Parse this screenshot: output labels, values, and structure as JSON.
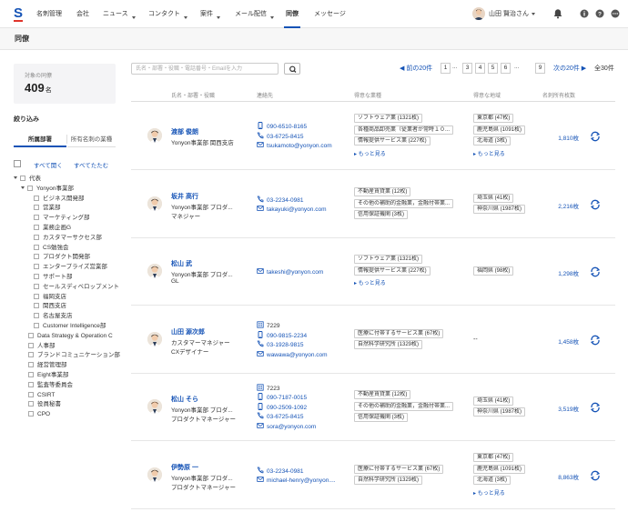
{
  "nav": {
    "logo": "S",
    "items": [
      {
        "label": "名刺管理",
        "caret": false
      },
      {
        "label": "会社",
        "caret": false
      },
      {
        "label": "ニュース",
        "caret": true
      },
      {
        "label": "コンタクト",
        "caret": true
      },
      {
        "label": "案件",
        "caret": true
      },
      {
        "label": "メール配信",
        "caret": true
      },
      {
        "label": "同僚",
        "caret": false
      },
      {
        "label": "メッセージ",
        "caret": false
      }
    ],
    "user_name": "山田 賢治さん",
    "icons": [
      "bell-icon",
      "info-icon",
      "help-icon",
      "more-icon"
    ]
  },
  "page": {
    "title": "同僚"
  },
  "summary": {
    "label": "対象の同僚",
    "value": "409",
    "unit": "名"
  },
  "filter": {
    "title": "絞り込み",
    "tab_own": "所属部署",
    "tab_all": "所有名刺の業種",
    "expand_all": "すべて開く",
    "collapse_all": "すべてたたむ",
    "tree": [
      "代表",
      "Yonyon事業部",
      "ビジネス開発部",
      "営業部",
      "マーケティング部",
      "業務企画G",
      "カスタマーサクセス部",
      "CS勉強会",
      "プロダクト開発部",
      "エンタープライズ営業部",
      "サポート部",
      "セールスディベロップメント",
      "福岡支店",
      "関西支店",
      "名古屋支店",
      "Customer Intelligence部",
      "Data Strategy & Operation C",
      "人事部",
      "ブランドコミュニケーション部",
      "経営管理部",
      "Eight事業部",
      "監査等委員会",
      "CSIRT",
      "役員秘書",
      "CPO"
    ]
  },
  "search": {
    "placeholder": "氏名・部署・役職・電話番号・Emailを入力"
  },
  "pager": {
    "prev": "前の20件",
    "next": "次の20件",
    "pages": [
      "1",
      "3",
      "4",
      "5",
      "6",
      "9"
    ],
    "dots": "...",
    "total": "全30件"
  },
  "table": {
    "headers": [
      "氏名・部署・役職",
      "連絡先",
      "得意な業種",
      "得意な地域",
      "名刺所有枚数"
    ],
    "rows": [
      {
        "name": "渡部 俊朗",
        "org": [
          "Yonyon事業部 関西支店"
        ],
        "contacts": [
          {
            "type": "mobile",
            "text": "090-6510-8165",
            "link": true
          },
          {
            "type": "phone",
            "text": "03-6725-8415",
            "link": true
          },
          {
            "type": "mail",
            "text": "tsukamoto@yonyon.com",
            "link": true
          }
        ],
        "industries": [
          "ソフトウェア業 (1321枚)",
          "各種商品卸売業（従業者が常時１０...",
          "情報提供サービス業 (227枚)"
        ],
        "industry_more": "もっと見る",
        "regions": [
          "東京都 (47枚)",
          "鹿児島県 (1091枚)",
          "北海道 (3枚)"
        ],
        "region_more": "もっと見る",
        "cards": "1,810枚"
      },
      {
        "name": "坂井 高行",
        "org": [
          "Yonyon事業部 プロダ...",
          "マネジャー"
        ],
        "contacts": [
          {
            "type": "phone",
            "text": "03-2234-0981",
            "link": true
          },
          {
            "type": "mail",
            "text": "takayuki@yonyon.com",
            "link": true
          }
        ],
        "industries": [
          "不動産賃貸業 (12枚)",
          "その他の補助的金融業，金融付帯業...",
          "信用保証機関 (3枚)"
        ],
        "industry_more": "",
        "regions": [
          "埼玉県 (41枚)",
          "神奈川県 (1987枚)"
        ],
        "region_more": "",
        "cards": "2,216枚"
      },
      {
        "name": "松山 武",
        "org": [
          "Yonyon事業部 プロダ...",
          "GL"
        ],
        "contacts": [
          {
            "type": "mail",
            "text": "takeshi@yonyon.com",
            "link": true
          }
        ],
        "industries": [
          "ソフトウェア業 (1321枚)",
          "情報提供サービス業 (227枚)"
        ],
        "industry_more": "もっと見る",
        "regions": [
          "福岡県 (98枚)"
        ],
        "region_more": "",
        "cards": "1,298枚"
      },
      {
        "name": "山田 源次郎",
        "org": [
          "カスタマーマネジャー",
          "CXデザイナー"
        ],
        "contacts": [
          {
            "type": "ext",
            "text": "7229",
            "link": false
          },
          {
            "type": "mobile",
            "text": "090-9815-2234",
            "link": true
          },
          {
            "type": "phone",
            "text": "03-1928-9815",
            "link": true
          },
          {
            "type": "mail",
            "text": "wawawa@yonyon.com",
            "link": true
          }
        ],
        "industries": [
          "医療に付帯するサービス業 (67枚)",
          "自然科学研究所 (1329枚)"
        ],
        "industry_more": "",
        "regions": [],
        "region_dash": "--",
        "region_more": "",
        "cards": "1,458枚"
      },
      {
        "name": "松山 そら",
        "org": [
          "Yonyon事業部 プロダ...",
          "プロダクトマネージャー"
        ],
        "contacts": [
          {
            "type": "ext",
            "text": "7223",
            "link": false
          },
          {
            "type": "mobile",
            "text": "090-7187-0015",
            "link": true
          },
          {
            "type": "mobile",
            "text": "090-2509-1092",
            "link": true
          },
          {
            "type": "phone",
            "text": "03-6725-8415",
            "link": true
          },
          {
            "type": "mail",
            "text": "sora@yonyon.com",
            "link": true
          }
        ],
        "industries": [
          "不動産賃貸業 (12枚)",
          "その他の補助的金融業，金融付帯業...",
          "信用保証機関 (3枚)"
        ],
        "industry_more": "",
        "regions": [
          "埼玉県 (41枚)",
          "神奈川県 (1987枚)"
        ],
        "region_more": "",
        "cards": "3,519枚"
      },
      {
        "name": "伊勢原 一",
        "org": [
          "Yonyon事業部 プロダ...",
          "プロダクトマネージャー"
        ],
        "contacts": [
          {
            "type": "phone",
            "text": "03-2234-0981",
            "link": true
          },
          {
            "type": "mail",
            "text": "michael-henry@yonyon....",
            "link": true
          }
        ],
        "industries": [
          "医療に付帯するサービス業 (67枚)",
          "自然科学研究所 (1329枚)"
        ],
        "industry_more": "",
        "regions": [
          "東京都 (47枚)",
          "鹿児島県 (1091枚)",
          "北海道 (3枚)"
        ],
        "region_more": "もっと見る",
        "cards": "8,863枚"
      }
    ]
  },
  "colors": {
    "accent": "#1553b6",
    "logo_red": "#e0342b"
  }
}
